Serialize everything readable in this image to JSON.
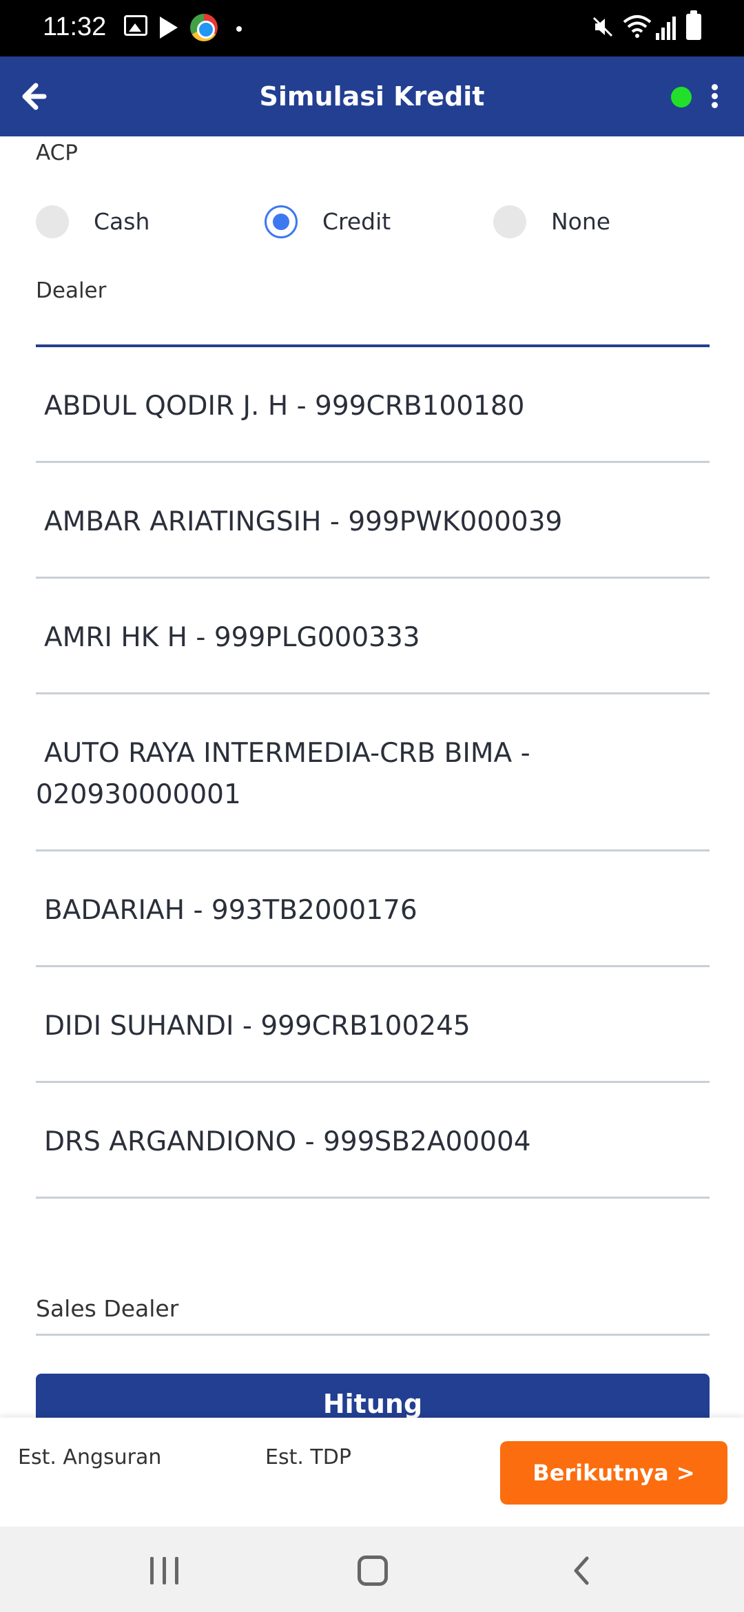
{
  "status_bar": {
    "time": "11:32",
    "left_icons": [
      "image-icon",
      "play-store-icon",
      "chrome-icon",
      "dot-icon"
    ],
    "right_icons": [
      "mute-icon",
      "wifi-icon",
      "signal-icon",
      "battery-icon"
    ]
  },
  "app_bar": {
    "title": "Simulasi Kredit",
    "back_icon": "arrow-left-icon",
    "status_color": "#22e02a",
    "menu_icon": "more-vert-icon",
    "background": "#233f92"
  },
  "form": {
    "acp_label": "ACP",
    "acp_options": [
      {
        "label": "Cash",
        "selected": false
      },
      {
        "label": "Credit",
        "selected": true
      },
      {
        "label": "None",
        "selected": false
      }
    ],
    "dealer_label": "Dealer",
    "dealer_options": [
      "ABDUL QODIR J. H - 999CRB100180",
      "AMBAR ARIATINGSIH - 999PWK000039",
      "AMRI HK H - 999PLG000333",
      "AUTO RAYA INTERMEDIA-CRB BIMA - 020930000001",
      "BADARIAH - 993TB2000176",
      "DIDI SUHANDI - 999CRB100245",
      "DRS ARGANDIONO - 999SB2A00004"
    ],
    "sales_dealer_label": "Sales Dealer",
    "calculate_button": "Hitung"
  },
  "summary": {
    "est_installment_label": "Est. Angsuran",
    "est_tdp_label": "Est. TDP",
    "next_button": "Berikutnya >",
    "next_color": "#fb6d0e"
  },
  "nav_bar": {
    "icons": [
      "recent-apps-icon",
      "home-icon",
      "back-icon"
    ]
  }
}
